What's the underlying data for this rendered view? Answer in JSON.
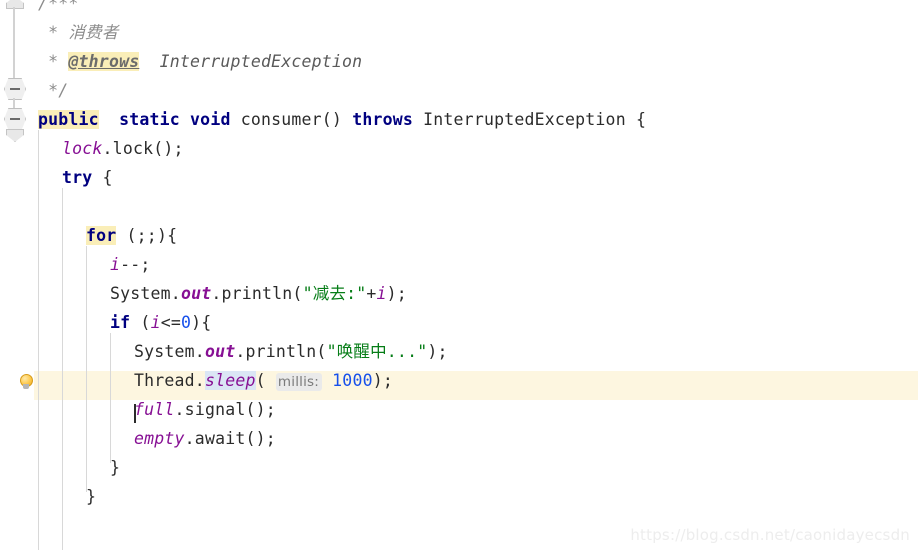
{
  "app": {
    "kind": "java-code-editor",
    "theme": "light"
  },
  "colors": {
    "background": "#ffffff",
    "keyword": "#000080",
    "string": "#067d17",
    "number": "#1750eb",
    "field": "#871094",
    "comment": "#8c8c8c",
    "search_highlight": "#faeeb8",
    "identifier_highlight": "#dbe6f5",
    "caret_line": "#fdf6e0",
    "param_hint_bg": "#eaeaea",
    "indent_guide": "#d8d8d8",
    "watermark": "#ededed"
  },
  "gutter": {
    "bulb_tooltip": "Show Context Actions",
    "fold_markers": [
      {
        "type": "fold-collapse",
        "line": 4
      },
      {
        "type": "fold-collapse",
        "line": 5
      }
    ]
  },
  "code": {
    "language": "Java",
    "lines": [
      {
        "n": 1,
        "indent": 0,
        "tokens": [
          {
            "t": "cmt",
            "v": "/***"
          }
        ]
      },
      {
        "n": 2,
        "indent": 0,
        "tokens": [
          {
            "t": "cmt",
            "v": " * 消费者"
          }
        ]
      },
      {
        "n": 3,
        "indent": 0,
        "tokens": [
          {
            "t": "cmt",
            "v": " * "
          },
          {
            "t": "cmt-tag hl-search",
            "v": "@throws"
          },
          {
            "t": "cmt-type",
            "v": "  InterruptedException"
          }
        ]
      },
      {
        "n": 4,
        "indent": 0,
        "tokens": [
          {
            "t": "cmt",
            "v": " */"
          }
        ]
      },
      {
        "n": 5,
        "indent": 0,
        "tokens": [
          {
            "t": "kw hl-search",
            "v": "public"
          },
          {
            "t": "plain",
            "v": "  "
          },
          {
            "t": "kw",
            "v": "static"
          },
          {
            "t": "plain",
            "v": " "
          },
          {
            "t": "kw",
            "v": "void"
          },
          {
            "t": "plain",
            "v": " consumer() "
          },
          {
            "t": "kw",
            "v": "throws"
          },
          {
            "t": "plain",
            "v": " InterruptedException {"
          }
        ]
      },
      {
        "n": 6,
        "indent": 1,
        "tokens": [
          {
            "t": "field",
            "v": "lock"
          },
          {
            "t": "plain",
            "v": ".lock();"
          }
        ]
      },
      {
        "n": 7,
        "indent": 1,
        "tokens": [
          {
            "t": "kw",
            "v": "try"
          },
          {
            "t": "plain",
            "v": " {"
          }
        ]
      },
      {
        "n": 8,
        "indent": 0,
        "tokens": []
      },
      {
        "n": 9,
        "indent": 2,
        "tokens": [
          {
            "t": "kw hl-search",
            "v": "for"
          },
          {
            "t": "plain",
            "v": " (;;){"
          }
        ]
      },
      {
        "n": 10,
        "indent": 3,
        "tokens": [
          {
            "t": "field",
            "v": "i"
          },
          {
            "t": "plain",
            "v": "--;"
          }
        ]
      },
      {
        "n": 11,
        "indent": 3,
        "tokens": [
          {
            "t": "plain",
            "v": "System."
          },
          {
            "t": "static-f",
            "v": "out"
          },
          {
            "t": "plain",
            "v": ".println("
          },
          {
            "t": "str",
            "v": "\"减去:\""
          },
          {
            "t": "plain",
            "v": "+"
          },
          {
            "t": "field",
            "v": "i"
          },
          {
            "t": "plain",
            "v": ");"
          }
        ]
      },
      {
        "n": 12,
        "indent": 3,
        "tokens": [
          {
            "t": "kw",
            "v": "if"
          },
          {
            "t": "plain",
            "v": " ("
          },
          {
            "t": "field",
            "v": "i"
          },
          {
            "t": "plain",
            "v": "<="
          },
          {
            "t": "num",
            "v": "0"
          },
          {
            "t": "plain",
            "v": "){"
          }
        ]
      },
      {
        "n": 13,
        "indent": 4,
        "tokens": [
          {
            "t": "plain",
            "v": "System."
          },
          {
            "t": "static-f",
            "v": "out"
          },
          {
            "t": "plain",
            "v": ".println("
          },
          {
            "t": "str",
            "v": "\"唤醒中...\""
          },
          {
            "t": "plain",
            "v": ");"
          }
        ]
      },
      {
        "n": 14,
        "indent": 4,
        "tokens": [
          {
            "t": "plain",
            "v": "Thread."
          },
          {
            "t": "field hl-ident",
            "v": "sleep"
          },
          {
            "t": "plain",
            "v": "( "
          },
          {
            "t": "hint",
            "v": "millis:"
          },
          {
            "t": "plain",
            "v": " "
          },
          {
            "t": "num",
            "v": "1000"
          },
          {
            "t": "plain",
            "v": ");"
          }
        ]
      },
      {
        "n": 15,
        "indent": 4,
        "tokens": [
          {
            "t": "field",
            "v": "full"
          },
          {
            "t": "plain",
            "v": ".signal();"
          }
        ]
      },
      {
        "n": 16,
        "indent": 4,
        "tokens": [
          {
            "t": "field",
            "v": "empty"
          },
          {
            "t": "plain",
            "v": ".await();"
          }
        ]
      },
      {
        "n": 17,
        "indent": 3,
        "tokens": [
          {
            "t": "plain",
            "v": "}"
          }
        ]
      },
      {
        "n": 18,
        "indent": 2,
        "tokens": [
          {
            "t": "plain",
            "v": "}"
          }
        ]
      }
    ]
  },
  "caret": {
    "line": 15,
    "column": 1
  },
  "highlighted_line": 14,
  "watermark": {
    "text": "https://blog.csdn.net/caonidayecsdn"
  }
}
